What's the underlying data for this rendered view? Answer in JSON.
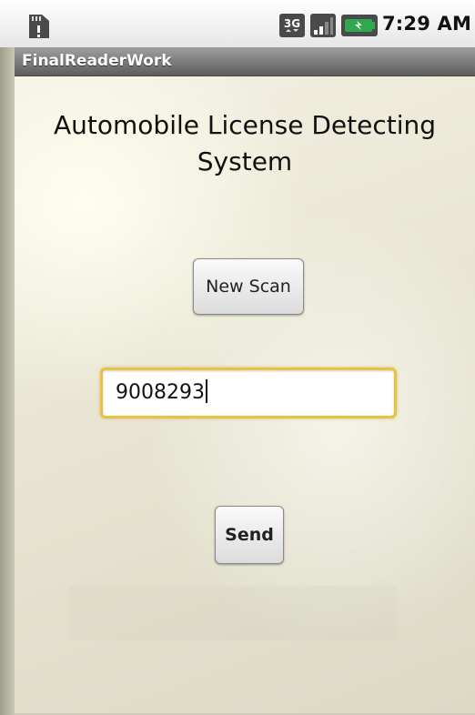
{
  "status_bar": {
    "time": "7:29 AM",
    "icons": [
      "sd-card-icon",
      "3g-network-icon",
      "signal-strength-icon",
      "battery-icon"
    ]
  },
  "app": {
    "title": "FinalReaderWork"
  },
  "main": {
    "heading": "Automobile License Detecting System",
    "new_scan_label": "New Scan",
    "license_input_value": "9008293",
    "send_label": "Send"
  },
  "colors": {
    "title_bar": "#7a7a7a",
    "input_focus_border": "#e8c242",
    "battery_green": "#2fa84f"
  }
}
